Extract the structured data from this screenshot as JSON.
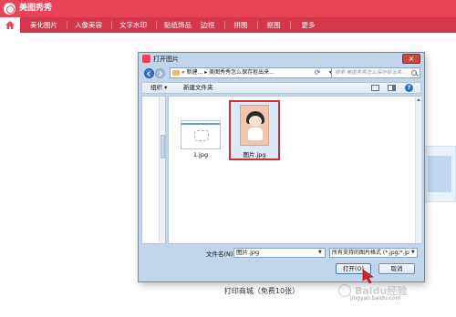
{
  "app": {
    "title": "美图秀秀",
    "brand_color": "#e9435a"
  },
  "nav": {
    "items": [
      {
        "label": "美化图片"
      },
      {
        "label": "人像美容"
      },
      {
        "label": "文字水印"
      },
      {
        "label": "贴纸饰品"
      },
      {
        "label": "边框"
      },
      {
        "label": "拼图"
      },
      {
        "label": "抠图"
      },
      {
        "label": "更多"
      }
    ]
  },
  "background": {
    "mall_text": "打印商城（免费10张）"
  },
  "dialog": {
    "title": "打开图片",
    "address": "« 新建... ▸ 美图秀秀怎么保存抠出来...",
    "search_placeholder": "搜索 美图秀秀怎么保存抠出来...",
    "toolbar": {
      "organize": "组织 ▾",
      "new_folder": "新建文件夹"
    },
    "files": [
      {
        "name": "1.jpg",
        "selected": false
      },
      {
        "name": "图片.jpg",
        "selected": true
      }
    ],
    "filename_label": "文件名(N):",
    "filename_value": "图片.jpg",
    "filetype_value": "所有支持的图片格式 (*.jpg;*.jp",
    "open_label": "打开(O)",
    "cancel_label": "取消"
  },
  "watermark": {
    "text": "Baidu经验",
    "sub": "jingyan.baidu.com"
  }
}
